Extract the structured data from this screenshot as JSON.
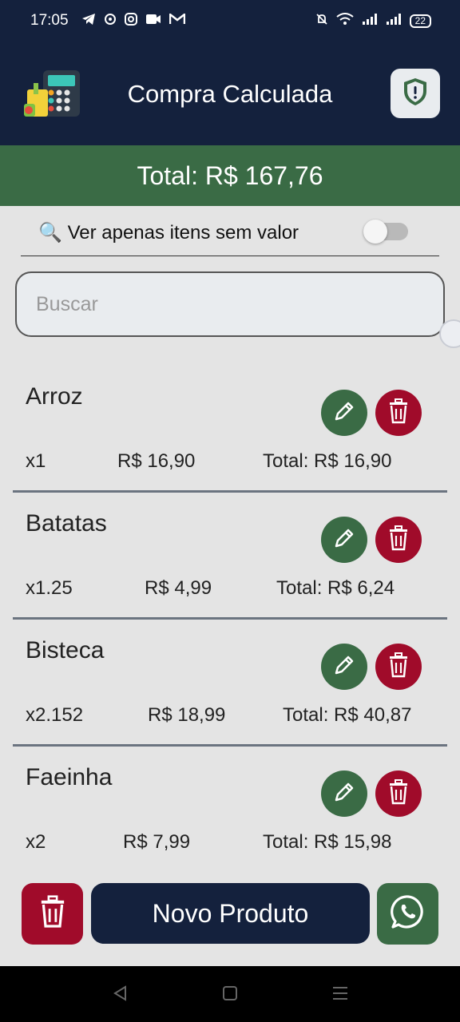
{
  "status": {
    "time": "17:05",
    "battery": "22",
    "icons": [
      "telegram-icon",
      "notification-icon",
      "instagram-icon",
      "video-icon",
      "gmail-icon"
    ]
  },
  "header": {
    "title": "Compra Calculada",
    "logo_icon": "calculator-groceries-icon",
    "shield_icon": "shield-alert-icon"
  },
  "total": {
    "label": "Total: R$ 167,76"
  },
  "filter": {
    "icon": "🔍",
    "label": "Ver apenas itens sem valor",
    "enabled": false
  },
  "search": {
    "placeholder": "Buscar",
    "value": ""
  },
  "items": [
    {
      "name": "Arroz",
      "qty": "x1",
      "price": "R$ 16,90",
      "total": "Total: R$ 16,90"
    },
    {
      "name": "Batatas",
      "qty": "x1.25",
      "price": "R$ 4,99",
      "total": "Total: R$ 6,24"
    },
    {
      "name": "Bisteca",
      "qty": "x2.152",
      "price": "R$ 18,99",
      "total": "Total: R$ 40,87"
    },
    {
      "name": "Faeinha",
      "qty": "x2",
      "price": "R$ 7,99",
      "total": "Total: R$ 15,98"
    }
  ],
  "actions": {
    "new_product": "Novo Produto"
  },
  "colors": {
    "navy": "#14213d",
    "green": "#3a6b45",
    "red": "#a00b2a",
    "background": "#e4e4e4"
  }
}
